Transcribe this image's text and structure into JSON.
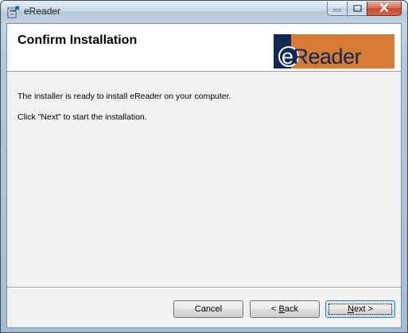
{
  "window": {
    "title": "eReader",
    "app_icon": "installer-package-icon",
    "controls": {
      "minimize_icon": "minimize-icon",
      "maximize_icon": "maximize-icon",
      "close_icon": "close-icon"
    }
  },
  "banner": {
    "title": "Confirm Installation",
    "logo_text_first": "e",
    "logo_text_rest": "Reader",
    "logo_colors": {
      "background": "#d57b35",
      "primary": "#0e2a55"
    }
  },
  "body": {
    "line1": "The installer is ready to install eReader on your computer.",
    "line2": "Click \"Next\" to start the installation."
  },
  "buttons": {
    "cancel": "Cancel",
    "back_prefix": "< ",
    "back_accel": "B",
    "back_rest": "ack",
    "next_accel": "N",
    "next_rest": "ext >"
  }
}
